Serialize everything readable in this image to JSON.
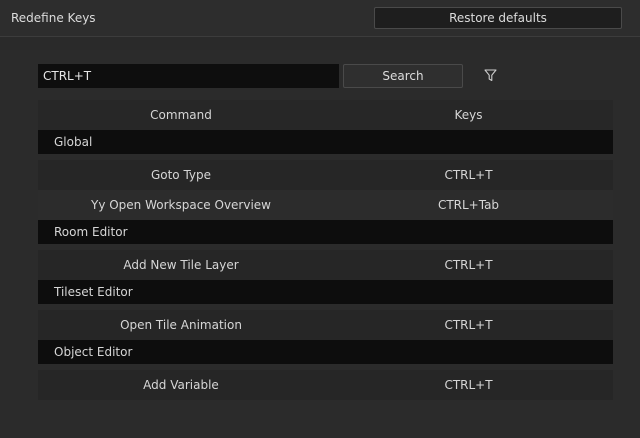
{
  "header": {
    "title": "Redefine Keys",
    "restore_label": "Restore defaults"
  },
  "search": {
    "value": "CTRL+T",
    "button_label": "Search",
    "filter_icon": "filter-icon"
  },
  "table": {
    "columns": [
      "Command",
      "Keys"
    ],
    "sections": [
      {
        "group": "Global",
        "rows": [
          {
            "command": "Goto Type",
            "keys": "CTRL+T"
          },
          {
            "command": "Yy Open Workspace Overview",
            "keys": "CTRL+Tab"
          }
        ]
      },
      {
        "group": "Room Editor",
        "rows": [
          {
            "command": "Add New Tile Layer",
            "keys": "CTRL+T"
          }
        ]
      },
      {
        "group": "Tileset Editor",
        "rows": [
          {
            "command": "Open Tile Animation",
            "keys": "CTRL+T"
          }
        ]
      },
      {
        "group": "Object Editor",
        "rows": [
          {
            "command": "Add Variable",
            "keys": "CTRL+T"
          }
        ]
      }
    ]
  },
  "colors": {
    "background": "#2b2b2b",
    "group_row": "#0d0d0d",
    "input_bg": "#0e0e0e"
  }
}
